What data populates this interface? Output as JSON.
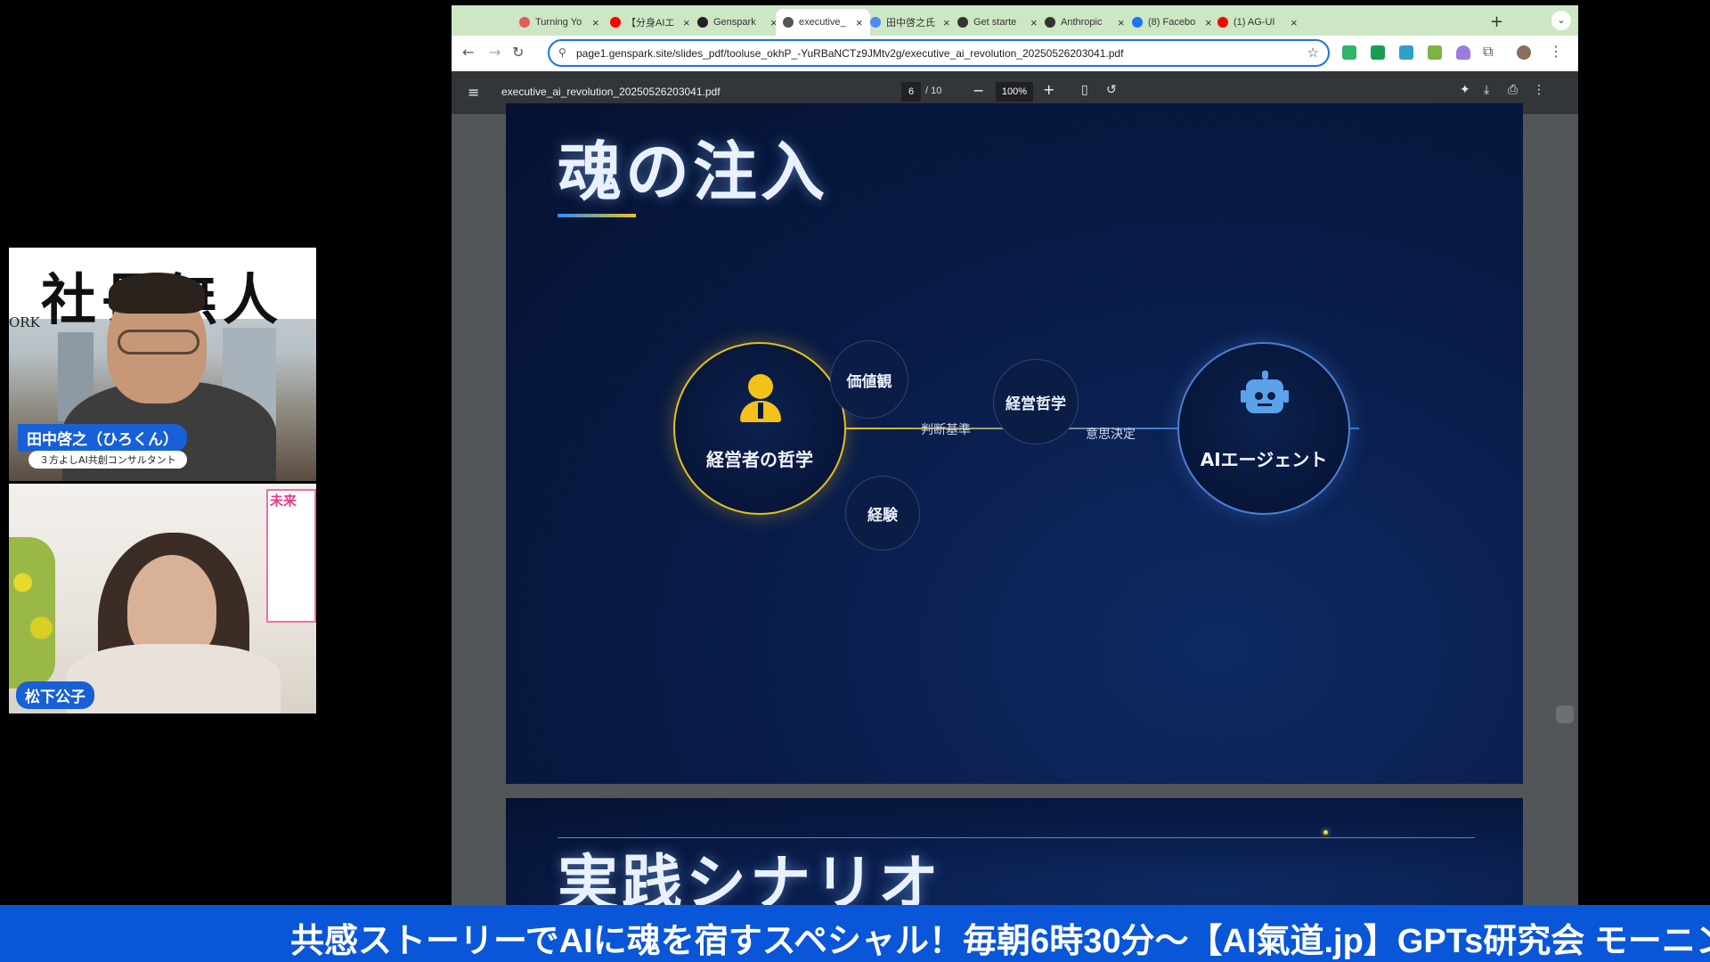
{
  "participants": [
    {
      "name": "田中啓之（ひろくん）",
      "subtitle": "３方よしAI共創コンサルタント",
      "background_book_text": "社長無人",
      "side_text": "ORK"
    },
    {
      "name": "松下公子",
      "background_book_text": "未来"
    }
  ],
  "browser": {
    "tabs": [
      {
        "label": "Turning Yo",
        "icon": "google-icon",
        "color": "#e35b5b"
      },
      {
        "label": "【分身AIエ",
        "icon": "youtube-icon",
        "color": "#ff0000"
      },
      {
        "label": "Genspark",
        "icon": "genspark-icon",
        "color": "#222222"
      },
      {
        "label": "executive_",
        "icon": "globe-icon",
        "color": "#555555",
        "active": true
      },
      {
        "label": "田中啓之氏",
        "icon": "gemini-icon",
        "color": "#4a8af4"
      },
      {
        "label": "Get starte",
        "icon": "anthropic-icon",
        "color": "#333333"
      },
      {
        "label": "Anthropic",
        "icon": "anthropic-icon",
        "color": "#333333"
      },
      {
        "label": "(8) Facebo",
        "icon": "facebook-icon",
        "color": "#1877f2"
      },
      {
        "label": "(1) AG-UI",
        "icon": "youtube-icon",
        "color": "#ff0000"
      }
    ],
    "new_tab": "+",
    "url": "page1.genspark.site/slides_pdf/tooluse_okhP_-YuRBaNCTz9JMtv2g/executive_ai_revolution_20250526203041.pdf"
  },
  "pdf_viewer": {
    "filename": "executive_ai_revolution_20250526203041.pdf",
    "current_page": "6",
    "total_pages": "/ 10",
    "zoom": "100%"
  },
  "slide": {
    "title": "魂の注入",
    "source_label": "経営者の哲学",
    "target_label": "AIエージェント",
    "bubbles": [
      "価値観",
      "経営哲学",
      "経験"
    ],
    "flow_labels": [
      "判断基準",
      "意思決定"
    ]
  },
  "next_slide": {
    "title": "実践シナリオ"
  },
  "ticker": {
    "text": "共感ストーリーでAIに魂を宿すスペシャル！毎朝6時30分～【AI氣道.jp】GPTs研究会 モーニング"
  }
}
